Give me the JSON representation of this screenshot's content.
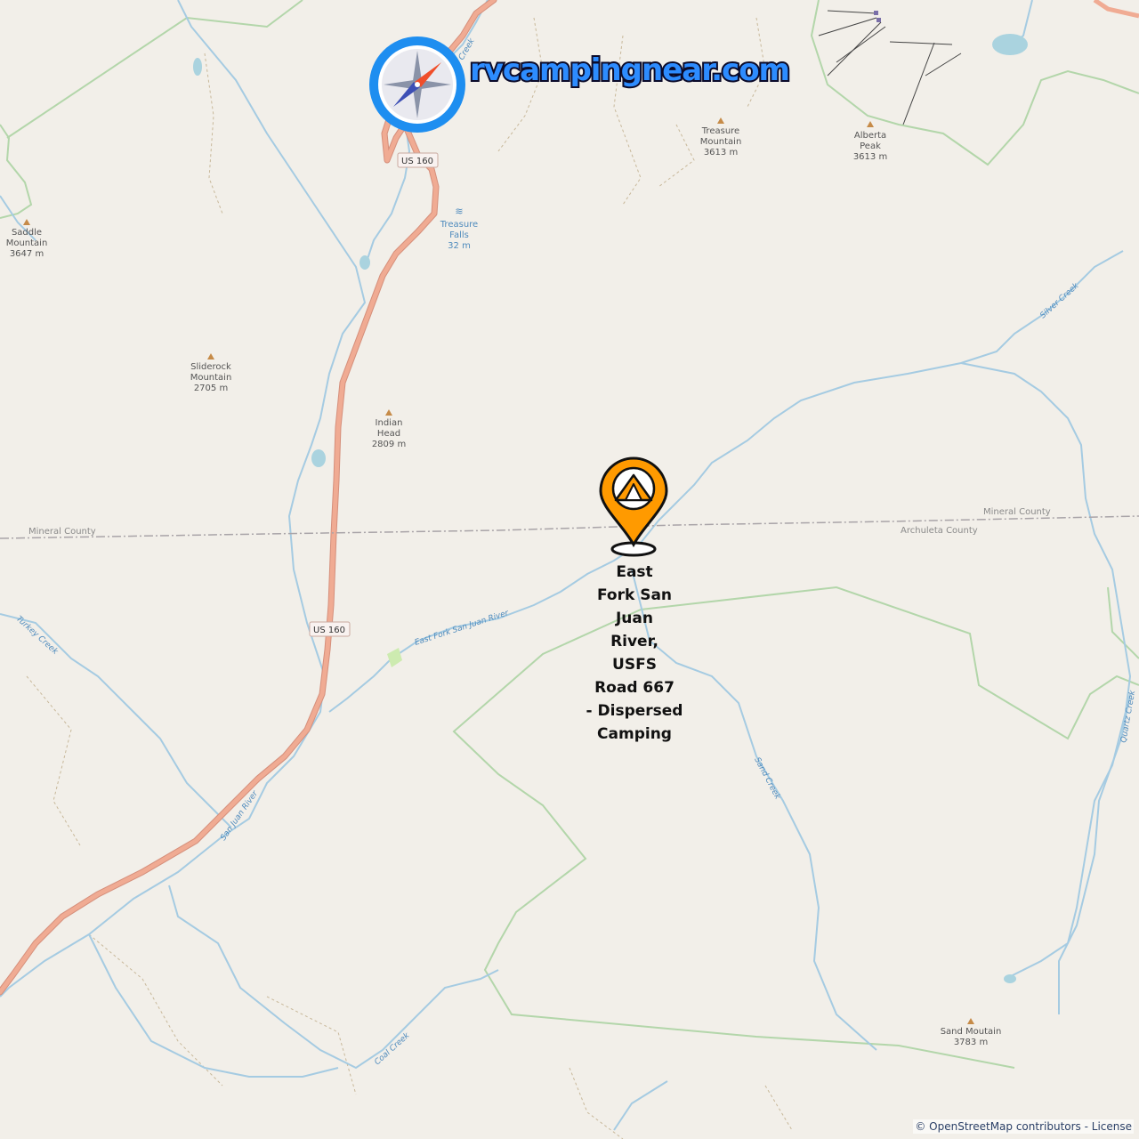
{
  "map": {
    "brand": "rvcampingnear.com",
    "attribution": "© OpenStreetMap contributors - License",
    "road_shields": [
      "US 160",
      "US 160"
    ],
    "counties": {
      "left": "Mineral County",
      "right_top": "Mineral County",
      "right_bottom": "Archuleta County"
    },
    "peaks": [
      {
        "name": "Saddle",
        "name2": "Mountain",
        "elev": "3647 m"
      },
      {
        "name": "Treasure",
        "name2": "Mountain",
        "elev": "3613 m"
      },
      {
        "name": "Alberta",
        "name2": "Peak",
        "elev": "3613 m"
      },
      {
        "name": "Sliderock",
        "name2": "Mountain",
        "elev": "2705 m"
      },
      {
        "name": "Indian",
        "name2": "Head",
        "elev": "2809 m"
      },
      {
        "name": "Sand Moutain",
        "name2": "",
        "elev": "3783 m"
      }
    ],
    "falls": {
      "name": "Treasure",
      "name2": "Falls",
      "elev": "32 m"
    },
    "waterways": {
      "silver_creek": "Silver Creek",
      "east_fork": "East Fork San Juan River",
      "turkey_creek": "Turkey Creek",
      "sand_creek": "Sand Creek",
      "quartz_creek": "Quartz Creek",
      "san_juan": "San Juan River",
      "coal_creek": "Coal Creek",
      "top_creek": "Creek"
    },
    "poi_lines": [
      "East",
      "Fork San",
      "Juan",
      "River,",
      "USFS",
      "Road 667",
      "- Dispersed",
      "Camping"
    ],
    "colors": {
      "background": "#f2efe9",
      "road": "#e8a18b",
      "water": "#9fc7e0",
      "boundary": "#a9d1a0",
      "marker": "#ff9a00",
      "brand": "#2d8cff"
    }
  }
}
